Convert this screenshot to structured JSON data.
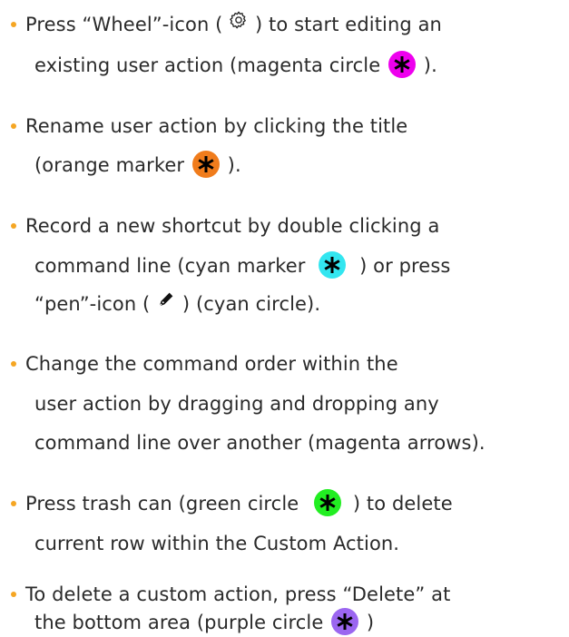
{
  "accent": {
    "bullet": "#f5a623",
    "magenta": "#ee00ee",
    "orange": "#f07c1c",
    "cyan": "#33e6f0",
    "green": "#22ee22",
    "purple": "#9b66f0"
  },
  "items": [
    {
      "line1_before": "Press “Wheel”-icon ( ",
      "icon": "gear-icon",
      "line1_after": " ) to start editing an",
      "line2_before": "existing user action (magenta circle ",
      "marker": "magenta",
      "line2_after": " )."
    },
    {
      "line1": "Rename user action by clicking the title",
      "line2_before": "(orange marker ",
      "marker": "orange",
      "line2_after": " )."
    },
    {
      "line1": "Record a new shortcut by double clicking a",
      "line2_before": "command line (cyan marker ",
      "marker": "cyan",
      "line2_after": " ) or press",
      "line3_before": "“pen”-icon ( ",
      "icon": "pen-icon",
      "line3_after": " ) (cyan circle)."
    },
    {
      "line1": "Change the command order within the",
      "line2": "user action by dragging and dropping any",
      "line3": "command line over another (magenta arrows)."
    },
    {
      "line1_before": "Press trash can (green circle ",
      "marker": "green",
      "line1_after": " ) to delete",
      "line2": "current row within the Custom Action."
    },
    {
      "line1": "To delete a custom action, press “Delete” at",
      "line2_before": "the bottom area (purple circle ",
      "marker": "purple",
      "line2_after": " )"
    }
  ]
}
